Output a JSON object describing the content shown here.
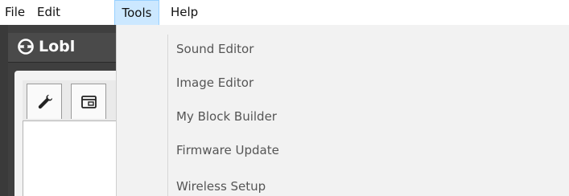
{
  "menubar": {
    "file": "File",
    "edit": "Edit",
    "tools": "Tools",
    "help": "Help"
  },
  "app": {
    "title_partial": "Lobl",
    "tabs": [
      {
        "icon": "wrench-icon"
      },
      {
        "icon": "window-icon"
      }
    ]
  },
  "tools_menu": {
    "items": [
      {
        "label": "Sound Editor"
      },
      {
        "label": "Image Editor"
      },
      {
        "label": "My Block Builder"
      },
      {
        "label": "Firmware Update"
      },
      {
        "label": "Wireless Setup"
      }
    ]
  },
  "colors": {
    "menu_highlight": "#cce8ff",
    "menu_highlight_border": "#99d1ff",
    "dropdown_bg": "#f2f2f2",
    "app_dark": "#3f3f3f",
    "menu_text": "#555555"
  }
}
